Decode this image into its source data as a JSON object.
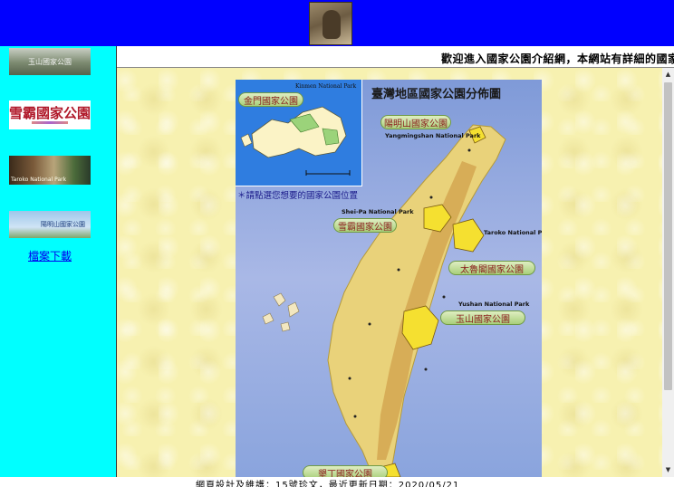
{
  "banner": {
    "photo_icon": "animal-photo"
  },
  "sidebar": {
    "images": [
      {
        "name": "sidebar-image-yushan",
        "text": "玉山國家公園"
      },
      {
        "name": "sidebar-image-sheipa",
        "text": "雪霸國家公園"
      },
      {
        "name": "sidebar-image-taroko",
        "text": "Taroko National Park"
      },
      {
        "name": "sidebar-image-yangmingshan",
        "text": "陽明山國家公園"
      }
    ],
    "download_link": "檔案下載"
  },
  "marquee": {
    "text": "歡迎進入國家公園介紹網，本網站有詳細的國家公"
  },
  "map": {
    "title": "臺灣地區國家公園分佈圖",
    "hint": "＊請點選您想要的國家公園位置",
    "inset_en": "Kinmen National Park",
    "parks": [
      {
        "id": "kinmen",
        "zh": "金門國家公園",
        "en": ""
      },
      {
        "id": "yangmingshan",
        "zh": "陽明山國家公園",
        "en": "Yangmingshan National Park"
      },
      {
        "id": "sheipa",
        "zh": "雪霸國家公園",
        "en": "Shei-Pa National Park"
      },
      {
        "id": "taroko",
        "zh": "太魯閣國家公園",
        "en": "Taroko National Park"
      },
      {
        "id": "yushan",
        "zh": "玉山國家公園",
        "en": "Yushan National Park"
      },
      {
        "id": "kenting",
        "zh": "墾丁國家公園",
        "en": ""
      }
    ]
  },
  "footer": {
    "text": "網頁設計及維護：15號珍文，最近更新日期：2020/05/21"
  },
  "colors": {
    "banner": "#0000ff",
    "sidebar": "#00ffff",
    "link": "#0000ee"
  }
}
